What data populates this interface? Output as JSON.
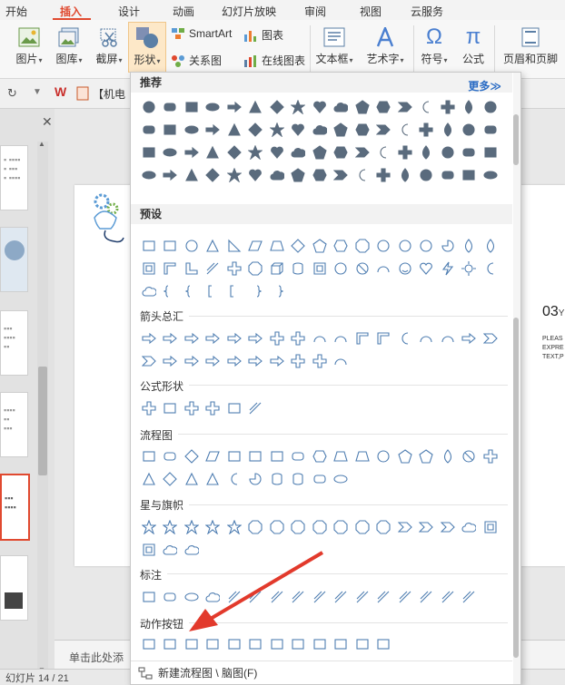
{
  "tabs": [
    "开始",
    "插入",
    "设计",
    "动画",
    "幻灯片放映",
    "审阅",
    "视图",
    "云服务"
  ],
  "ribbon": {
    "picture": "图片",
    "library": "图库",
    "screenshot": "截屏",
    "shapes": "形状",
    "smartart": "SmartArt",
    "chart": "图表",
    "relation": "关系图",
    "online_chart": "在线图表",
    "textbox": "文本框",
    "wordart": "艺术字",
    "symbol": "符号",
    "formula": "公式",
    "header_footer": "页眉和页脚"
  },
  "qat": {
    "doc_tab": "【机电"
  },
  "panel": {
    "recommended": "推荐",
    "more": "更多≫",
    "preset": "预设",
    "arrows": "箭头总汇",
    "formula_shapes": "公式形状",
    "flowchart": "流程图",
    "stars": "星与旗帜",
    "callouts": "标注",
    "action_buttons": "动作按钮",
    "footer": "新建流程图 \\ 脑图(F)"
  },
  "slide": {
    "num": "03",
    "num_suffix": "Y",
    "body1": "PLEAS",
    "body2": "EXPRE",
    "body3": "TEXT,P"
  },
  "notes": {
    "placeholder": "单击此处添"
  },
  "status": {
    "text": "幻灯片 14 / 21"
  },
  "colors": {
    "accent": "#e0492f",
    "icon_blue": "#5b7fa6",
    "link": "#2b6cc4"
  }
}
